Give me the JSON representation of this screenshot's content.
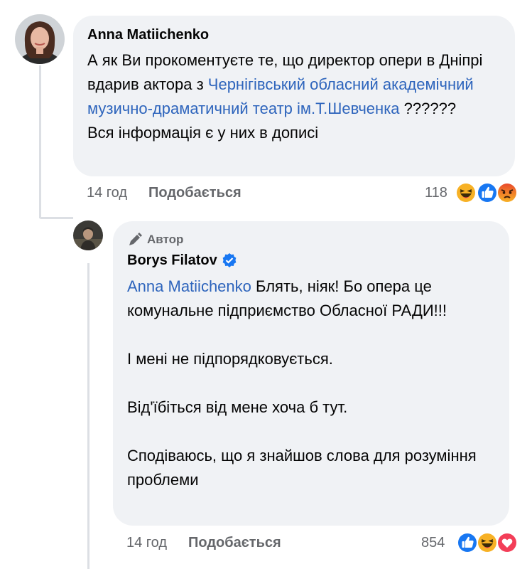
{
  "comment": {
    "author": "Anna Matiichenko",
    "text_part1": "А як Ви прокоментуєте те, що директор опери в Дніпрі вдарив актора з ",
    "link": "Чернігівський обласний академічний музично-драматичний театр ім.Т.Шевченка",
    "text_part2": " ??????",
    "text_line2": "Вся інформація є у них в дописі",
    "time": "14 год",
    "like_label": "Подобається",
    "reaction_count": "118"
  },
  "reply": {
    "badge": "Автор",
    "author": "Borys Filatov",
    "mention": "Anna Matiichenko",
    "text_p1": " Блять, ніяк! Бо опера це комунальне підприємство Обласної РАДИ!!!",
    "text_p2": "І мені не підпорядковується.",
    "text_p3": "Від'їбіться від мене хоча б тут.",
    "text_p4": "Сподіваюсь, що я знайшов слова для розуміння проблеми",
    "time": "14 год",
    "like_label": "Подобається",
    "reaction_count": "854"
  },
  "colors": {
    "bubble": "#f0f2f5",
    "link": "#2d64bc",
    "meta": "#65676b",
    "like_blue": "#1877f2",
    "angry": "#e9713c",
    "love": "#f33e58",
    "haha": "#f7b125"
  },
  "icons": {
    "verified": "verified-badge-icon",
    "author_badge": "author-pen-icon",
    "like": "like-reaction-icon",
    "haha": "haha-reaction-icon",
    "angry": "angry-reaction-icon",
    "love": "love-reaction-icon"
  }
}
